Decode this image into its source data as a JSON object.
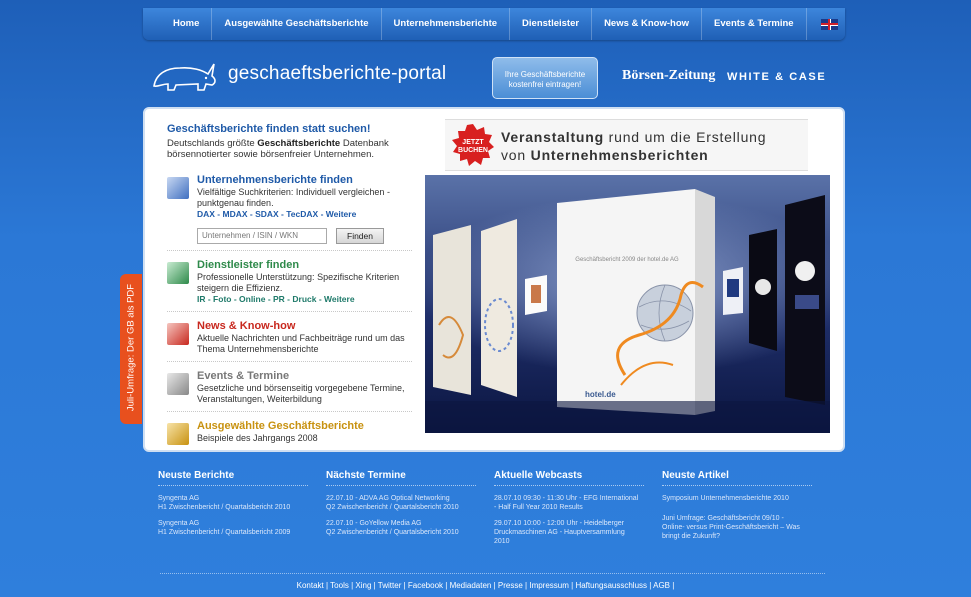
{
  "nav": {
    "items": [
      "Home",
      "Ausgewählte Geschäftsberichte",
      "Unternehmensberichte",
      "Dienstleister",
      "News & Know-how",
      "Events & Termine"
    ]
  },
  "header": {
    "site_name": "geschaeftsberichte-portal",
    "cta_line1": "Ihre Geschäftsberichte",
    "cta_line2": "kostenfrei eintragen!",
    "partner1": "Börsen-Zeitung",
    "partner2": "WHITE & CASE"
  },
  "side_tab": "Juli-Umfrage: Der GB als PDF",
  "left": {
    "headline": "Geschäftsberichte finden statt suchen!",
    "intro_pre": "Deutschlands größte ",
    "intro_bold": "Geschäftsberichte",
    "intro_post": " Datenbank börsennotierter sowie börsenfreier Unternehmen.",
    "sections": [
      {
        "title": "Unternehmensberichte finden",
        "desc": "Vielfältige Suchkriterien: Individuell vergleichen - punktgenau finden.",
        "links": "DAX - MDAX - SDAX - TecDAX - Weitere",
        "color": "#1f5aa8"
      },
      {
        "title": "Dienstleister finden",
        "desc": "Professionelle Unterstützung: Spezifische Kriterien steigern die Effizienz.",
        "links": "IR - Foto - Online - PR - Druck - Weitere",
        "color": "#2e8a4a"
      },
      {
        "title": "News & Know-how",
        "desc": "Aktuelle Nachrichten und Fachbeiträge rund um das Thema Unternehmensberichte",
        "links": "",
        "color": "#c8281e"
      },
      {
        "title": "Events & Termine",
        "desc": "Gesetzliche und börsenseitig vorgegebene Termine, Veranstaltungen, Weiterbildung",
        "links": "",
        "color": "#777777"
      },
      {
        "title": "Ausgewählte Geschäftsberichte",
        "desc": "Beispiele des Jahrgangs 2008",
        "links": "",
        "color": "#c89210"
      }
    ],
    "search_placeholder": "Unternehmen / ISIN / WKN",
    "search_button": "Finden"
  },
  "banner": {
    "badge_line1": "JETZT",
    "badge_line2": "BUCHEN",
    "l1_bold": "Veranstaltung",
    "l1_rest": " rund um die Erstellung",
    "l2_pre": "von ",
    "l2_bold": "Unternehmensberichten"
  },
  "stage": {
    "card_title": "Geschäftsbericht 2009 der hotel.de AG",
    "card_brand": "hotel.de"
  },
  "footer": {
    "columns": [
      {
        "title": "Neuste Berichte",
        "entries": [
          [
            "Syngenta AG",
            "H1 Zwischenbericht / Quartalsbericht 2010"
          ],
          [
            "Syngenta AG",
            "H1 Zwischenbericht / Quartalsbericht 2009"
          ]
        ]
      },
      {
        "title": "Nächste Termine",
        "entries": [
          [
            "22.07.10 - ADVA AG Optical Networking",
            "Q2 Zwischenbericht / Quartalsbericht 2010"
          ],
          [
            "22.07.10 - GoYellow Media AG",
            "Q2 Zwischenbericht / Quartalsbericht 2010"
          ]
        ]
      },
      {
        "title": "Aktuelle Webcasts",
        "entries": [
          [
            "28.07.10 09:30 - 11:30 Uhr - EFG International",
            "- Half Full Year 2010 Results"
          ],
          [
            "29.07.10 10:00 - 12:00 Uhr - Heidelberger",
            "Druckmaschinen AG - Hauptversammlung",
            "2010"
          ]
        ]
      },
      {
        "title": "Neuste Artikel",
        "entries": [
          [
            "Symposium Unternehmensberichte 2010"
          ],
          [
            "Juni Umfrage: Geschäftsbericht 09/10 -",
            "Online- versus Print-Geschäftsbericht – Was",
            "bringt die Zukunft?"
          ]
        ]
      }
    ],
    "links": [
      "Kontakt",
      "Tools",
      "Xing",
      "Twitter",
      "Facebook",
      "Mediadaten",
      "Presse",
      "Impressum",
      "Haftungsausschluss",
      "AGB"
    ]
  },
  "colors": {
    "background": "#2b78d6",
    "nav": "#1f5fb5",
    "accent_blue": "#1f5aa8",
    "side_tab": "#e8501e"
  }
}
